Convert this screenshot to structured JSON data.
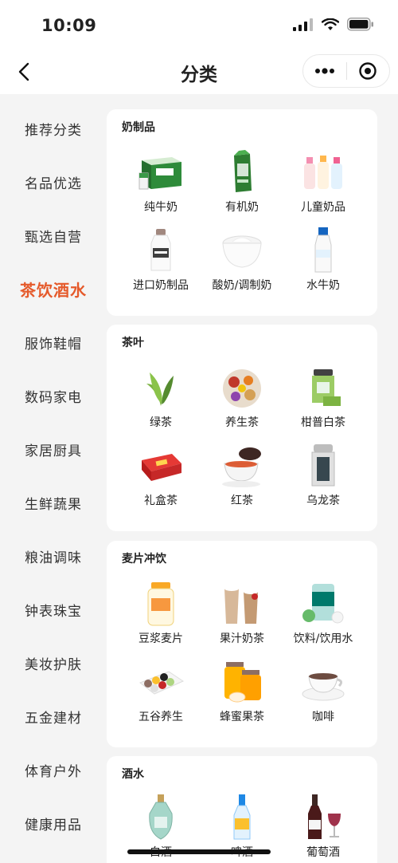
{
  "status_bar": {
    "time": "10:09"
  },
  "nav": {
    "title": "分类"
  },
  "sidebar": {
    "items": [
      {
        "label": "推荐分类",
        "active": false
      },
      {
        "label": "名品优选",
        "active": false
      },
      {
        "label": "甄选自营",
        "active": false
      },
      {
        "label": "茶饮酒水",
        "active": true
      },
      {
        "label": "服饰鞋帽",
        "active": false
      },
      {
        "label": "数码家电",
        "active": false
      },
      {
        "label": "家居厨具",
        "active": false
      },
      {
        "label": "生鲜蔬果",
        "active": false
      },
      {
        "label": "粮油调味",
        "active": false
      },
      {
        "label": "钟表珠宝",
        "active": false
      },
      {
        "label": "美妆护肤",
        "active": false
      },
      {
        "label": "五金建材",
        "active": false
      },
      {
        "label": "体育户外",
        "active": false
      },
      {
        "label": "健康用品",
        "active": false
      }
    ]
  },
  "sections": [
    {
      "title": "奶制品",
      "items": [
        {
          "label": "纯牛奶",
          "icon": "milk-carton-box-icon"
        },
        {
          "label": "有机奶",
          "icon": "organic-milk-icon"
        },
        {
          "label": "儿童奶品",
          "icon": "kids-milk-bottles-icon"
        },
        {
          "label": "进口奶制品",
          "icon": "imported-milk-bottle-icon"
        },
        {
          "label": "酸奶/调制奶",
          "icon": "yogurt-bowl-icon"
        },
        {
          "label": "水牛奶",
          "icon": "buffalo-milk-bottle-icon"
        }
      ]
    },
    {
      "title": "茶叶",
      "items": [
        {
          "label": "绿茶",
          "icon": "green-tea-leaf-icon"
        },
        {
          "label": "养生茶",
          "icon": "herbal-tea-icon"
        },
        {
          "label": "柑普白茶",
          "icon": "tea-tin-icon"
        },
        {
          "label": "礼盒茶",
          "icon": "gift-box-tea-icon"
        },
        {
          "label": "红茶",
          "icon": "black-tea-cup-icon"
        },
        {
          "label": "乌龙茶",
          "icon": "oolong-tin-icon"
        }
      ]
    },
    {
      "title": "麦片冲饮",
      "items": [
        {
          "label": "豆浆麦片",
          "icon": "oatmeal-jar-icon"
        },
        {
          "label": "果汁奶茶",
          "icon": "milk-tea-cups-icon"
        },
        {
          "label": "饮料/饮用水",
          "icon": "drink-can-icon"
        },
        {
          "label": "五谷养生",
          "icon": "grains-tray-icon"
        },
        {
          "label": "蜂蜜果茶",
          "icon": "honey-jar-icon"
        },
        {
          "label": "咖啡",
          "icon": "coffee-cup-icon"
        }
      ]
    },
    {
      "title": "酒水",
      "items": [
        {
          "label": "白酒",
          "icon": "baijiu-bottle-icon"
        },
        {
          "label": "啤酒",
          "icon": "beer-bottle-icon"
        },
        {
          "label": "葡萄酒",
          "icon": "wine-bottle-glass-icon"
        }
      ]
    }
  ],
  "colors": {
    "accent": "#e55a2b",
    "background": "#f4f4f4",
    "card": "#ffffff"
  }
}
